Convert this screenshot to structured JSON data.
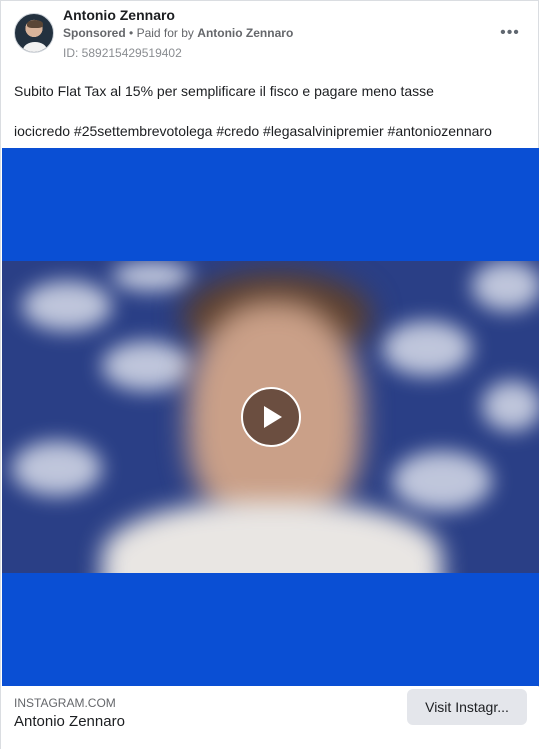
{
  "advertiser": {
    "name": "Antonio Zennaro",
    "sponsored_label": "Sponsored",
    "separator": "•",
    "paid_for_prefix": "Paid for by",
    "paid_for_name": "Antonio Zennaro",
    "ad_id": "ID: 589215429519402"
  },
  "more_icon": "more-horizontal-icon",
  "more_glyph": "•••",
  "post": {
    "text": "Subito Flat Tax al 15% per semplificare il fisco e pagare meno tasse",
    "hashtags": "iocicredo #25settembrevotolega #credo #legasalvinipremier #antoniozennaro"
  },
  "media": {
    "type": "video",
    "background_color": "#0a4fd4",
    "play_icon": "play-icon"
  },
  "link": {
    "domain": "INSTAGRAM.COM",
    "title": "Antonio Zennaro",
    "cta_label": "Visit Instagr..."
  }
}
